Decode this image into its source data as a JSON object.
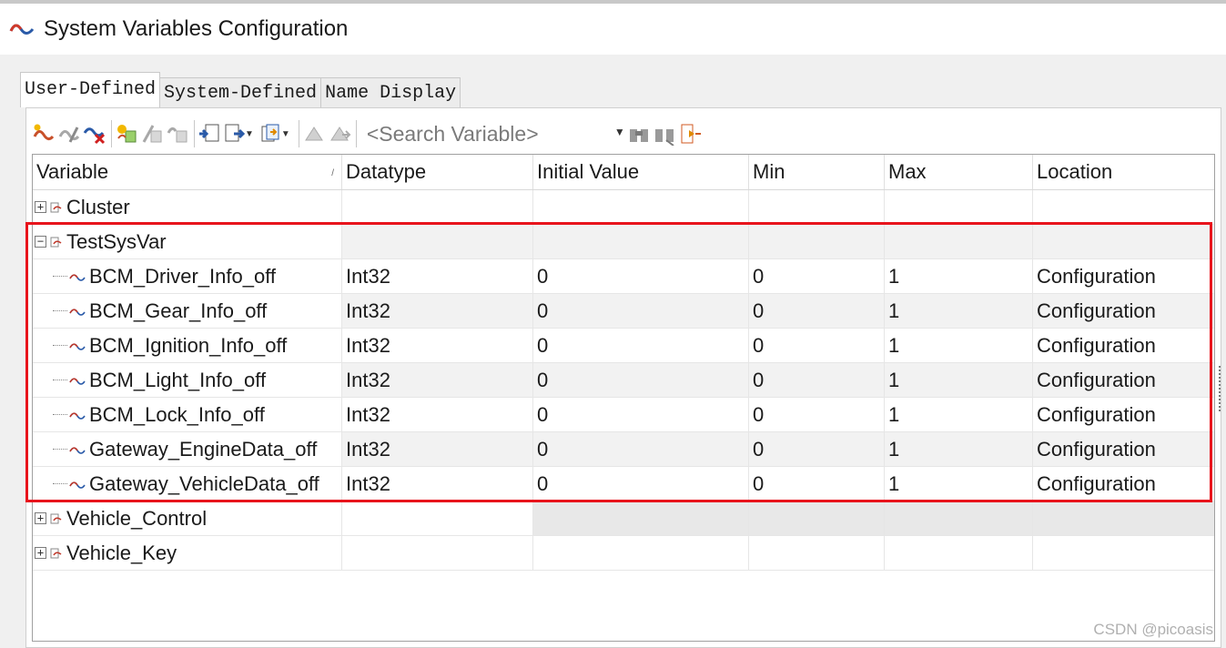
{
  "window": {
    "title": "System Variables Configuration"
  },
  "tabs": [
    {
      "label": "User-Defined",
      "active": true
    },
    {
      "label": "System-Defined",
      "active": false
    },
    {
      "label": "Name Display",
      "active": false
    }
  ],
  "toolbar": {
    "search_placeholder": "<Search Variable>",
    "buttons": [
      "new-variable-icon",
      "edit-variable-icon",
      "delete-variable-icon",
      "new-namespace-icon",
      "edit-namespace-icon",
      "delete-namespace-icon",
      "import-icon",
      "export-icon",
      "copy-icon",
      "move-up-icon",
      "move-down-icon",
      "find-icon",
      "find-next-icon",
      "show-structure-icon"
    ]
  },
  "grid": {
    "columns": [
      "Variable",
      "Datatype",
      "Initial Value",
      "Min",
      "Max",
      "Location"
    ],
    "rows": [
      {
        "type": "namespace",
        "expanded": false,
        "name": "Cluster",
        "datatype": "",
        "initial": "",
        "min": "",
        "max": "",
        "location": ""
      },
      {
        "type": "namespace",
        "expanded": true,
        "name": "TestSysVar",
        "datatype": "",
        "initial": "",
        "min": "",
        "max": "",
        "location": ""
      },
      {
        "type": "variable",
        "name": "BCM_Driver_Info_off",
        "datatype": "Int32",
        "initial": "0",
        "min": "0",
        "max": "1",
        "location": "Configuration"
      },
      {
        "type": "variable",
        "name": "BCM_Gear_Info_off",
        "datatype": "Int32",
        "initial": "0",
        "min": "0",
        "max": "1",
        "location": "Configuration"
      },
      {
        "type": "variable",
        "name": "BCM_Ignition_Info_off",
        "datatype": "Int32",
        "initial": "0",
        "min": "0",
        "max": "1",
        "location": "Configuration"
      },
      {
        "type": "variable",
        "name": "BCM_Light_Info_off",
        "datatype": "Int32",
        "initial": "0",
        "min": "0",
        "max": "1",
        "location": "Configuration"
      },
      {
        "type": "variable",
        "name": "BCM_Lock_Info_off",
        "datatype": "Int32",
        "initial": "0",
        "min": "0",
        "max": "1",
        "location": "Configuration"
      },
      {
        "type": "variable",
        "name": "Gateway_EngineData_off",
        "datatype": "Int32",
        "initial": "0",
        "min": "0",
        "max": "1",
        "location": "Configuration"
      },
      {
        "type": "variable",
        "name": "Gateway_VehicleData_off",
        "datatype": "Int32",
        "initial": "0",
        "min": "0",
        "max": "1",
        "location": "Configuration"
      },
      {
        "type": "namespace",
        "expanded": false,
        "name": "Vehicle_Control",
        "datatype": "",
        "initial": "",
        "min": "",
        "max": "",
        "location": ""
      },
      {
        "type": "namespace",
        "expanded": false,
        "name": "Vehicle_Key",
        "datatype": "",
        "initial": "",
        "min": "",
        "max": "",
        "location": ""
      }
    ]
  },
  "watermark": "CSDN @picoasis",
  "colors": {
    "highlight": "#e8141c",
    "accent_red": "#c0392b",
    "accent_blue": "#2a5aa8"
  }
}
